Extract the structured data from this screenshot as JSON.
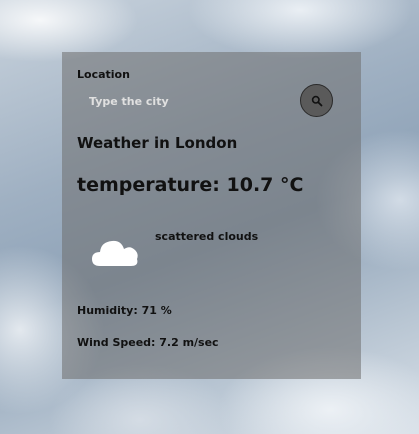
{
  "search": {
    "label": "Location",
    "placeholder": "Type the city",
    "icon": "search-icon"
  },
  "weather": {
    "city_heading": "Weather in London",
    "temperature": "temperature: 10.7 °C",
    "description": "scattered clouds",
    "icon": "scattered-clouds-icon",
    "humidity": "Humidity: 71 %",
    "wind": "Wind Speed: 7.2 m/sec"
  }
}
